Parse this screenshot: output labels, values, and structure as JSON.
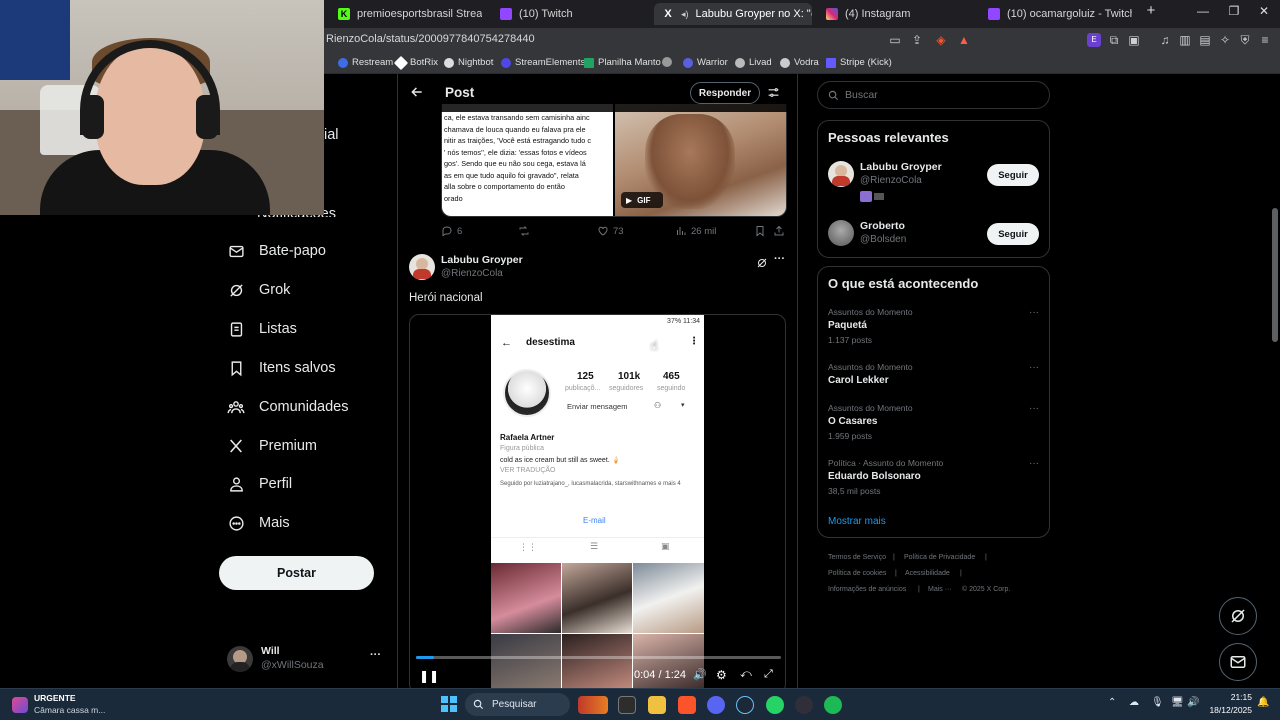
{
  "browser": {
    "tabs": [
      {
        "label": "premioesportsbrasil Stream - Watch",
        "fav": "K"
      },
      {
        "label": "(10) Twitch",
        "fav": ""
      },
      {
        "label": "Labubu Groyper no X: \"@Bol",
        "fav": "X"
      },
      {
        "label": "(4) Instagram",
        "fav": ""
      },
      {
        "label": "(10) ocamargoluiz - Twitch",
        "fav": ""
      }
    ],
    "url": "RienzoCola/status/2000977840754278440",
    "bookmarks": [
      "Restream",
      "BotRix",
      "Nightbot",
      "StreamElements",
      "Planilha Manto",
      "",
      "Warrior",
      "Livad",
      "Vodra",
      "Stripe (Kick)"
    ]
  },
  "nav": {
    "partial_top": "ial",
    "partial_notifications": "Notificações",
    "items": [
      "Bate-papo",
      "Grok",
      "Listas",
      "Itens salvos",
      "Comunidades",
      "Premium",
      "Perfil",
      "Mais"
    ],
    "post_button": "Postar",
    "account_name": "Will",
    "account_handle": "@xWillSouza",
    "account_more": "···"
  },
  "header": {
    "title": "Post",
    "reply": "Responder"
  },
  "quoted": {
    "lines": [
      "ca, ele estava transando sem camisinha ainc",
      "chamava de louca quando eu falava pra ele",
      "nitir as traições, 'Você está estragando tudo c",
      "' nós temos'', ele dizia: 'essas fotos e vídeos",
      "gos'. Sendo que eu não sou cega, estava lá",
      "as em que tudo aquilo foi gravado\", relata",
      "alla sobre o comportamento do então",
      "orado"
    ],
    "gif_label": "GIF"
  },
  "actions": {
    "replies": "6",
    "retweets": "",
    "likes": "73",
    "views": "26 mil"
  },
  "tweet": {
    "author": "Labubu Groyper",
    "handle": "@RienzoCola",
    "text": "Herói nacional"
  },
  "phone": {
    "status": "37%  11:34",
    "profile_name": "desestima",
    "posts": "125",
    "posts_label": "publicaçõ...",
    "followers": "101k",
    "followers_label": "seguidores",
    "following": "465",
    "following_label": "seguindo",
    "message_btn": "Enviar mensagem",
    "name": "Rafaela Artner",
    "category": "Figura pública",
    "bio": "cold as ice cream but still as sweet. 🍦",
    "translate": "VER TRADUÇÃO",
    "followed_by": "Seguido por luziatrajano_, lucasmalacrida, starswithnames e mais 4",
    "email": "E-mail"
  },
  "video": {
    "time": "0:04 / 1:24",
    "progress": 0.05
  },
  "right": {
    "search_placeholder": "Buscar",
    "people_title": "Pessoas relevantes",
    "people": [
      {
        "name": "Labubu Groyper",
        "handle": "@RienzoCola",
        "button": "Seguir"
      },
      {
        "name": "Groberto",
        "handle": "@Bolsden",
        "button": "Seguir"
      }
    ],
    "trends_title": "O que está acontecendo",
    "trends": [
      {
        "category": "Assuntos do Momento",
        "name": "Paquetá",
        "count": "1.137 posts"
      },
      {
        "category": "Assuntos do Momento",
        "name": "Carol Lekker",
        "count": ""
      },
      {
        "category": "Assuntos do Momento",
        "name": "O Casares",
        "count": "1.959 posts"
      },
      {
        "category": "Política · Assunto do Momento",
        "name": "Eduardo Bolsonaro",
        "count": "38,5 mil posts"
      }
    ],
    "show_more": "Mostrar mais",
    "footer": [
      "Termos de Serviço",
      "Política de Privacidade",
      "Política de cookies",
      "Acessibilidade",
      "Informações de anúncios",
      "Mais ···",
      "© 2025 X Corp."
    ]
  },
  "taskbar": {
    "notification_title": "URGENTE",
    "notification_sub": "Câmara cassa m...",
    "search": "Pesquisar",
    "time": "21:15",
    "date": "18/12/2025"
  },
  "colors": {
    "accent": "#1d9bf0",
    "bg": "#000000",
    "muted": "#71767b"
  }
}
